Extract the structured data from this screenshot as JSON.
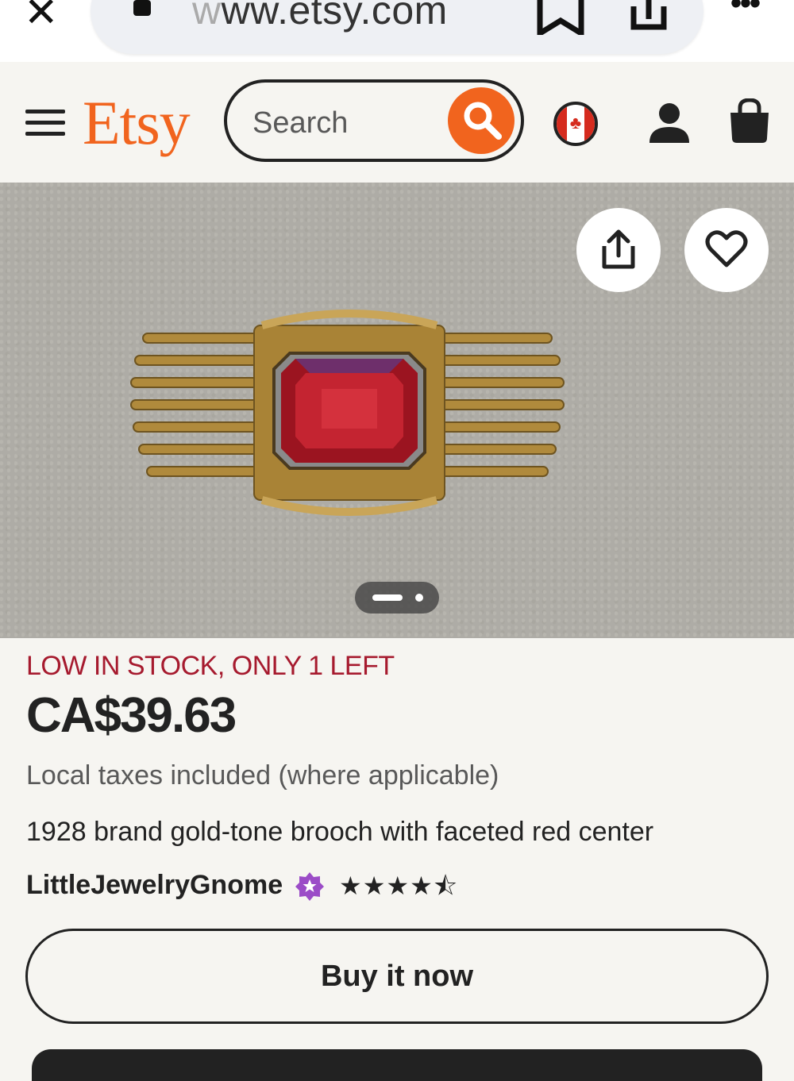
{
  "browser": {
    "url_prefix": "w",
    "url_text": "ww.etsy.com",
    "close_icon": "close-icon",
    "lock_icon": "lock-icon",
    "bookmark_icon": "bookmark-icon",
    "share_icon": "share-icon",
    "more_label": "•••"
  },
  "header": {
    "logo": "Etsy",
    "search_placeholder": "Search",
    "region_icon": "canada-flag-icon",
    "user_icon": "user-icon",
    "cart_icon": "shopping-bag-icon"
  },
  "gallery": {
    "share_icon": "share-icon",
    "favorite_icon": "heart-icon",
    "image_count": 2,
    "current_image": 1
  },
  "listing": {
    "stock_notice": "LOW IN STOCK, ONLY 1 LEFT",
    "price": "CA$39.63",
    "tax_note": "Local taxes included (where applicable)",
    "title": "1928 brand gold-tone brooch with faceted red center",
    "shop_name": "LittleJewelryGnome",
    "star_seller_badge": "star-seller-icon",
    "rating": 4.5,
    "rating_stars": "★★★★⯪"
  },
  "actions": {
    "buy_now_label": "Buy it now",
    "add_to_cart_label": ""
  },
  "colors": {
    "brand_orange": "#f1641e",
    "stock_red": "#a61a2e",
    "background": "#f6f5f1",
    "text_dark": "#222222",
    "star_seller_purple": "#9b4cc7"
  }
}
